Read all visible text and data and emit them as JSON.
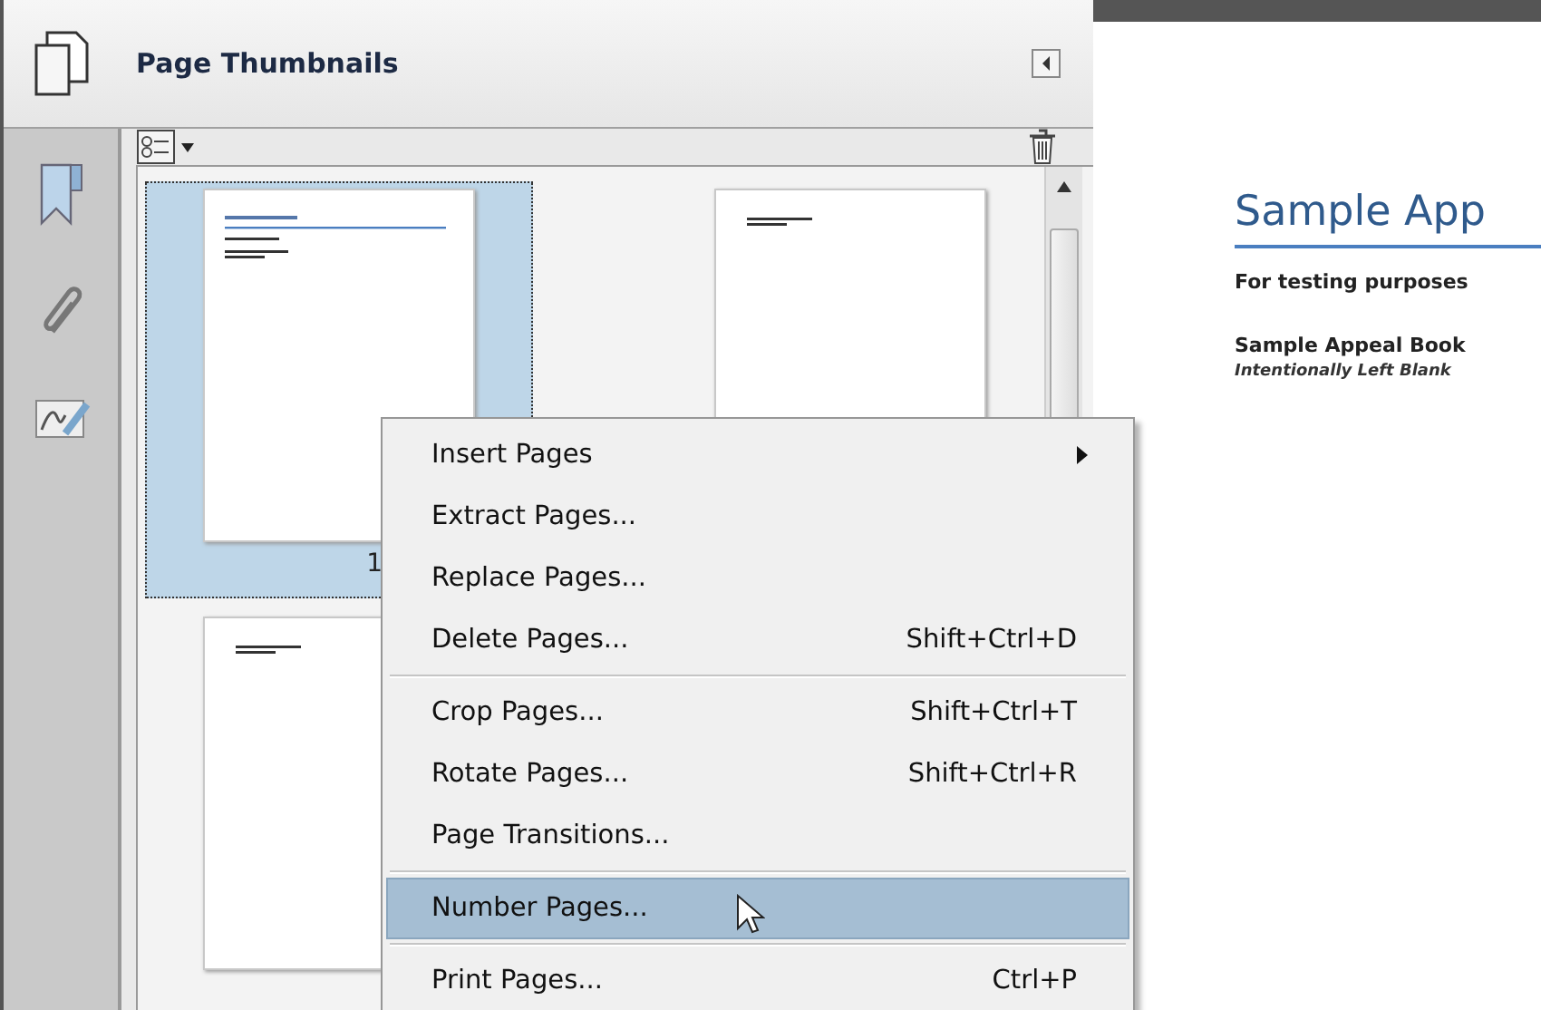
{
  "panel": {
    "title": "Page Thumbnails"
  },
  "thumbnails": [
    {
      "label": "1",
      "selected": true,
      "kind": "title"
    },
    {
      "selected": false,
      "kind": "blank"
    },
    {
      "selected": false,
      "kind": "blank"
    }
  ],
  "context_menu": [
    {
      "kind": "item",
      "label": "Insert Pages",
      "submenu": true,
      "selected": false
    },
    {
      "kind": "item",
      "label": "Extract Pages...",
      "submenu": false,
      "selected": false
    },
    {
      "kind": "item",
      "label": "Replace Pages...",
      "submenu": false,
      "selected": false
    },
    {
      "kind": "item",
      "label": "Delete Pages...",
      "shortcut": "Shift+Ctrl+D",
      "submenu": false,
      "selected": false
    },
    {
      "kind": "separator"
    },
    {
      "kind": "item",
      "label": "Crop Pages...",
      "shortcut": "Shift+Ctrl+T",
      "submenu": false,
      "selected": false
    },
    {
      "kind": "item",
      "label": "Rotate Pages...",
      "shortcut": "Shift+Ctrl+R",
      "submenu": false,
      "selected": false
    },
    {
      "kind": "item",
      "label": "Page Transitions...",
      "submenu": false,
      "selected": false
    },
    {
      "kind": "separator"
    },
    {
      "kind": "item",
      "label": "Number Pages...",
      "submenu": false,
      "selected": true
    },
    {
      "kind": "separator"
    },
    {
      "kind": "item",
      "label": "Print Pages...",
      "shortcut": "Ctrl+P",
      "submenu": false,
      "selected": false
    }
  ],
  "document": {
    "title": "Sample App",
    "subtitle": "For testing purposes",
    "heading": "Sample Appeal Book",
    "note": "Intentionally Left Blank"
  }
}
